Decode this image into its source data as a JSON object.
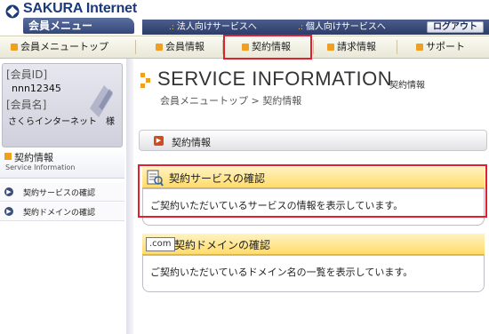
{
  "header": {
    "brand": "SAKURA Internet",
    "subtitle": "会員メニュー",
    "links": [
      "法人向けサービスへ",
      "個人向けサービスへ"
    ],
    "logout": "ログアウト"
  },
  "nav": {
    "items": [
      "会員メニュートップ",
      "会員情報",
      "契約情報",
      "請求情報",
      "サポート"
    ],
    "active_index": 2
  },
  "sidebar": {
    "member_id_label": "[会員ID]",
    "member_id": "nnn12345",
    "member_name_label": "[会員名]",
    "member_name": "さくらインターネット　様",
    "section_title": "契約情報",
    "section_title_en": "Service Information",
    "links": [
      "契約サービスの確認",
      "契約ドメインの確認"
    ]
  },
  "main": {
    "title": "SERVICE INFORMATION",
    "title_ja": "契約情報",
    "breadcrumb": "会員メニュートップ > 契約情報",
    "section_bar": "契約情報",
    "panels": [
      {
        "heading": "契約サービスの確認",
        "body": "ご契約いただいているサービスの情報を表示しています。",
        "icon": "document-icon"
      },
      {
        "heading": "契約ドメインの確認",
        "icon_text": ".com",
        "body": "ご契約いただいているドメイン名の一覧を表示しています。",
        "icon": "com-domain-icon"
      }
    ]
  },
  "colors": {
    "brand": "#1a3a7a",
    "topbar": "#34477a",
    "accent": "#f0a020",
    "highlight": "#e02030",
    "panel_head": "#ffdb6a"
  }
}
